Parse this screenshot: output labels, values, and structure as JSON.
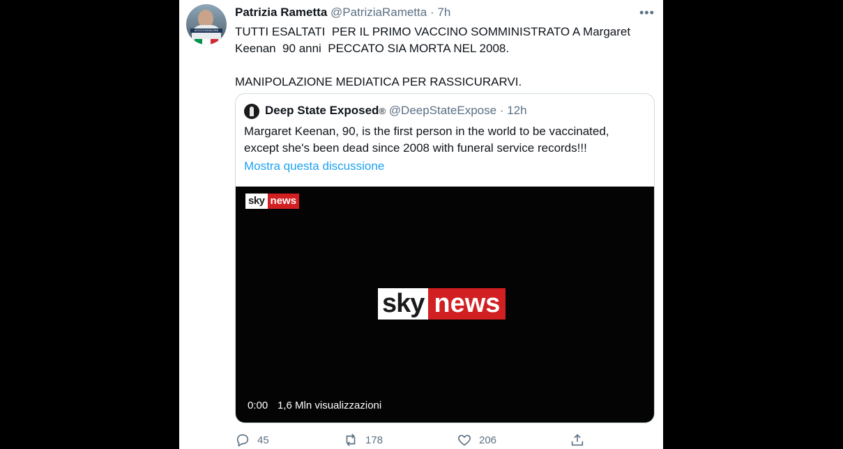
{
  "tweet": {
    "author_name": "Patrizia Rametta",
    "author_handle": "@PatriziaRametta",
    "separator": "·",
    "time": "7h",
    "more_label": "•••",
    "text": "TUTTI ESALTATI  PER IL PRIMO VACCINO SOMMINISTRATO A Margaret Keenan  90 anni  PECCATO SIA MORTA NEL 2008.\n\nMANIPOLAZIONE MEDIATICA PER RASSICURARVI.",
    "avatar_banner": "#STOCONSALVINI"
  },
  "quoted": {
    "author_name": "Deep State Exposed",
    "badge": "®",
    "author_handle": "@DeepStateExpose",
    "separator": "·",
    "time": "12h",
    "text": "Margaret Keenan, 90, is the first person in the world to be vaccinated, except she's been dead since  2008 with funeral service records!!!",
    "show_thread_link": "Mostra questa discussione"
  },
  "video": {
    "logo_small": {
      "sky": "sky",
      "news": "news"
    },
    "logo_big": {
      "sky": "sky",
      "news": "news"
    },
    "current_time": "0:00",
    "views": "1,6 Mln visualizzazioni"
  },
  "actions": {
    "replies": "45",
    "retweets": "178",
    "likes": "206"
  },
  "colors": {
    "background": "#000000",
    "card": "#ffffff",
    "secondary_text": "#5b7083",
    "link": "#1da1f2",
    "sky_red": "#d11f22"
  }
}
